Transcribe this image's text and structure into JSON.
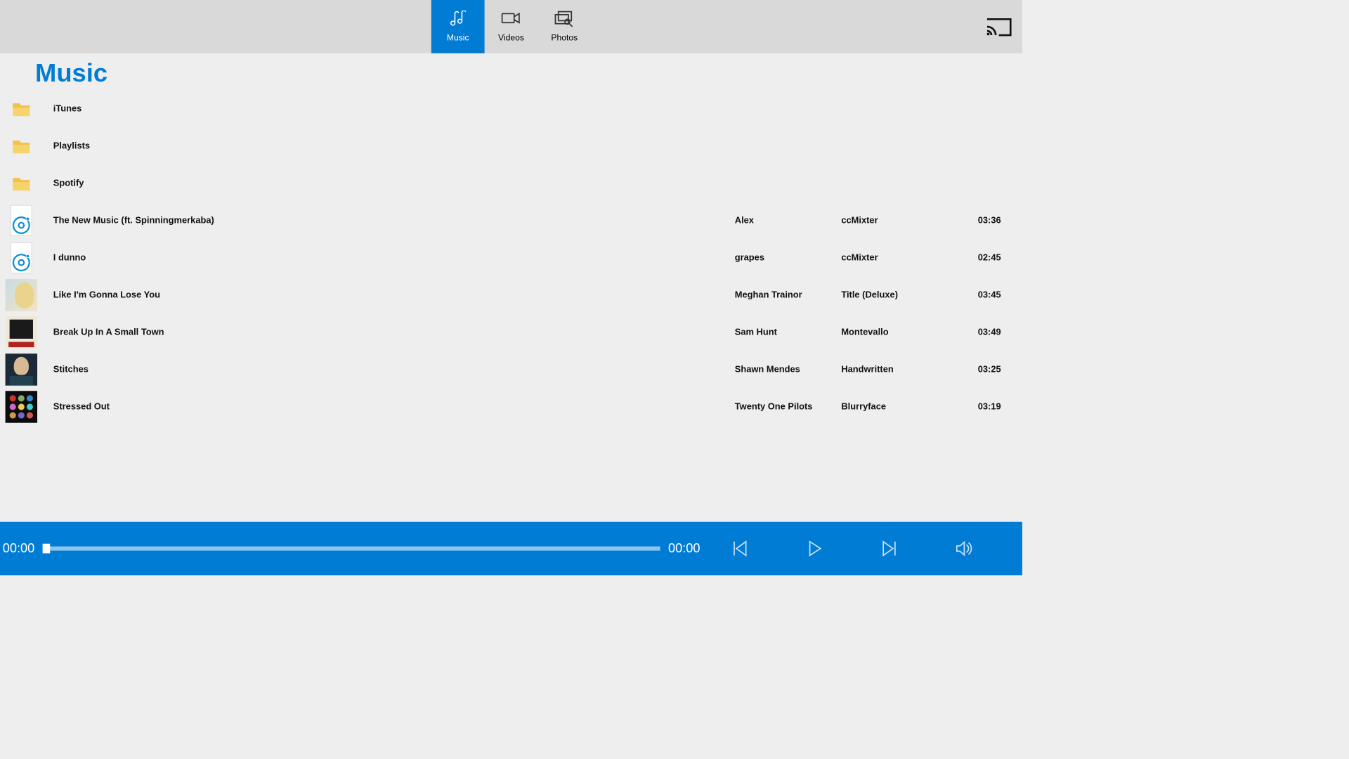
{
  "header": {
    "tabs": [
      {
        "id": "music",
        "label": "Music",
        "active": true
      },
      {
        "id": "videos",
        "label": "Videos",
        "active": false
      },
      {
        "id": "photos",
        "label": "Photos",
        "active": false
      }
    ]
  },
  "page_title": "Music",
  "folders": [
    {
      "name": "iTunes"
    },
    {
      "name": "Playlists"
    },
    {
      "name": "Spotify"
    }
  ],
  "tracks": [
    {
      "title": "The New Music (ft. Spinningmerkaba)",
      "artist": "Alex",
      "album": "ccMixter",
      "duration": "03:36",
      "art": "disc"
    },
    {
      "title": "I dunno",
      "artist": "grapes",
      "album": "ccMixter",
      "duration": "02:45",
      "art": "disc"
    },
    {
      "title": "Like I'm Gonna Lose You",
      "artist": "Meghan Trainor",
      "album": "Title (Deluxe)",
      "duration": "03:45",
      "art": "meghan"
    },
    {
      "title": "Break Up In A Small Town",
      "artist": "Sam Hunt",
      "album": "Montevallo",
      "duration": "03:49",
      "art": "sam"
    },
    {
      "title": "Stitches",
      "artist": "Shawn Mendes",
      "album": "Handwritten",
      "duration": "03:25",
      "art": "shawn"
    },
    {
      "title": "Stressed Out",
      "artist": "Twenty One Pilots",
      "album": "Blurryface",
      "duration": "03:19",
      "art": "top"
    }
  ],
  "player": {
    "elapsed": "00:00",
    "total": "00:00",
    "progress": 0
  }
}
